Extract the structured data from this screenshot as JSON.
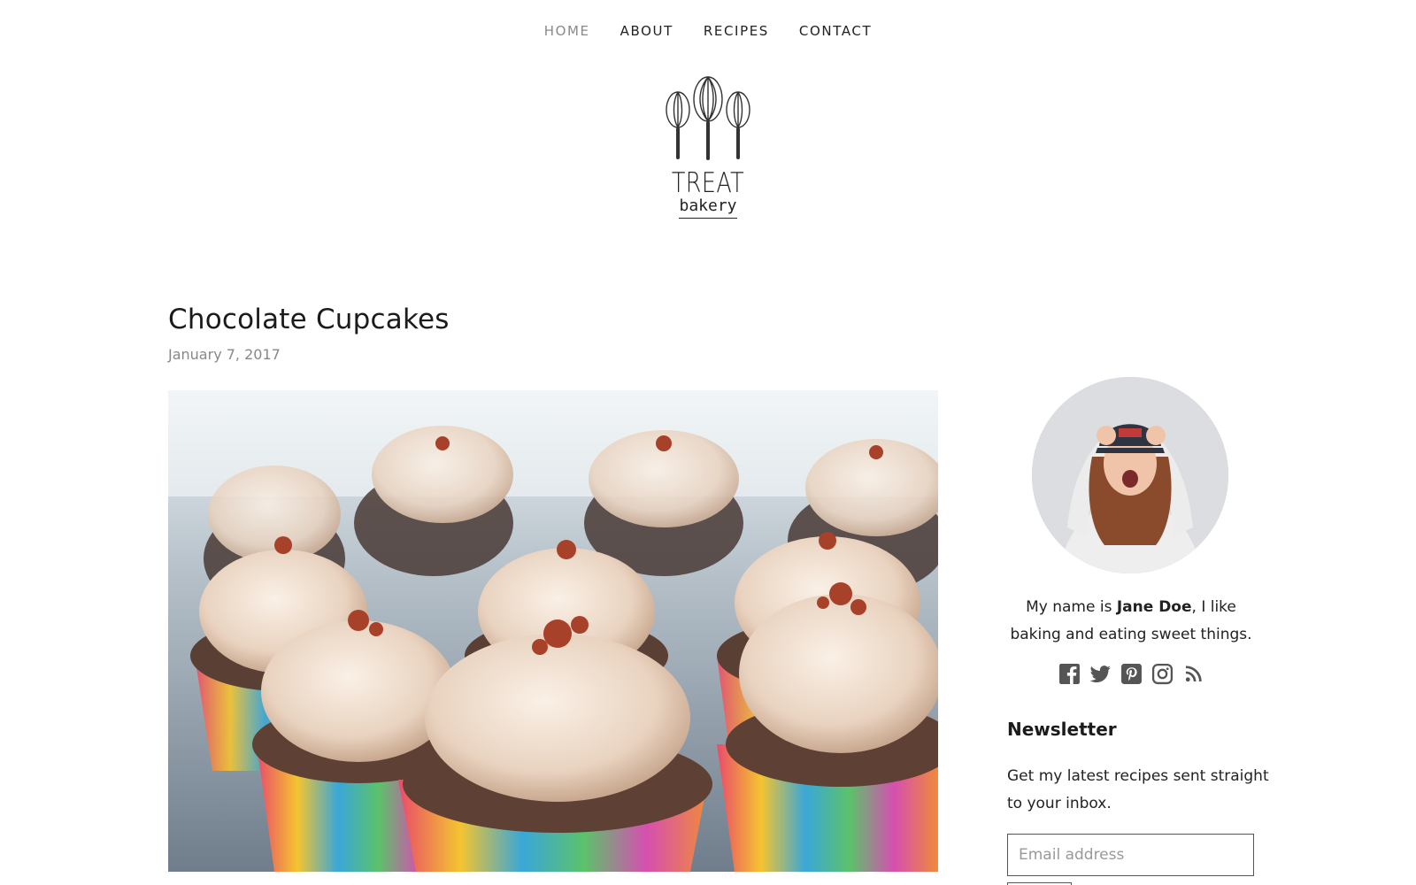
{
  "nav": {
    "items": [
      {
        "label": "HOME",
        "active": true
      },
      {
        "label": "ABOUT",
        "active": false
      },
      {
        "label": "RECIPES",
        "active": false
      },
      {
        "label": "CONTACT",
        "active": false
      }
    ]
  },
  "logo": {
    "word": "TREAT",
    "sub": "bakery"
  },
  "post": {
    "title": "Chocolate Cupcakes",
    "date": "January 7, 2017",
    "image": "chocolate-cupcakes-photo"
  },
  "sidebar": {
    "avatar": "author-photo",
    "bio_prefix": "My name is ",
    "bio_name": "Jane Doe",
    "bio_suffix": ", I like baking and eating sweet things.",
    "social": [
      "facebook-icon",
      "twitter-icon",
      "pinterest-icon",
      "instagram-icon",
      "rss-icon"
    ],
    "newsletter": {
      "title": "Newsletter",
      "text": "Get my latest recipes sent straight to your inbox.",
      "placeholder": "Email address"
    }
  },
  "colors": {
    "text": "#222222",
    "muted": "#888888",
    "nav_active": "#8a8a8a",
    "icon": "#555555"
  }
}
